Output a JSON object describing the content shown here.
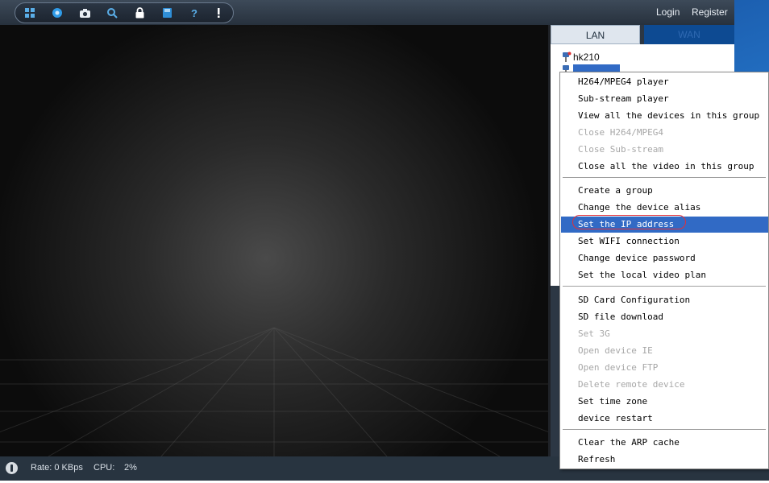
{
  "topbar": {
    "toolbar_icons": [
      "fullscreen-icon",
      "record-icon",
      "snapshot-icon",
      "search-icon",
      "lock-icon",
      "save-icon",
      "help-icon",
      "about-icon"
    ],
    "login_label": "Login",
    "register_label": "Register"
  },
  "panel": {
    "tabs": [
      "LAN",
      "WAN"
    ],
    "devices": [
      "hk210",
      ""
    ]
  },
  "context_menu": {
    "group1": [
      {
        "label": "H264/MPEG4 player",
        "enabled": true
      },
      {
        "label": "Sub-stream player",
        "enabled": true
      },
      {
        "label": "View all the devices in this group",
        "enabled": true
      },
      {
        "label": "Close H264/MPEG4",
        "enabled": false
      },
      {
        "label": "Close Sub-stream",
        "enabled": false
      },
      {
        "label": "Close all the video in this group",
        "enabled": true
      }
    ],
    "group2": [
      {
        "label": "Create a group",
        "enabled": true
      },
      {
        "label": "Change the device alias",
        "enabled": true
      },
      {
        "label": "Set the IP address",
        "enabled": true,
        "highlighted": true
      },
      {
        "label": "Set WIFI connection",
        "enabled": true
      },
      {
        "label": "Change device password",
        "enabled": true
      },
      {
        "label": "Set the local video plan",
        "enabled": true
      }
    ],
    "group3": [
      {
        "label": "SD Card Configuration",
        "enabled": true
      },
      {
        "label": "SD file download",
        "enabled": true
      },
      {
        "label": "Set 3G",
        "enabled": false
      },
      {
        "label": "Open device IE",
        "enabled": false
      },
      {
        "label": "Open device FTP",
        "enabled": false
      },
      {
        "label": "Delete remote device",
        "enabled": false
      },
      {
        "label": "Set time zone",
        "enabled": true
      },
      {
        "label": "device restart",
        "enabled": true
      }
    ],
    "group4": [
      {
        "label": "Clear the ARP cache",
        "enabled": true
      },
      {
        "label": "Refresh",
        "enabled": true
      }
    ]
  },
  "status": {
    "rate_label": "Rate: 0 KBps",
    "cpu_label": "CPU:",
    "cpu_value": "2%"
  },
  "colors": {
    "highlight": "#316ac5",
    "annotation_circle": "#e0303a",
    "topbar": "#3d4a59"
  }
}
